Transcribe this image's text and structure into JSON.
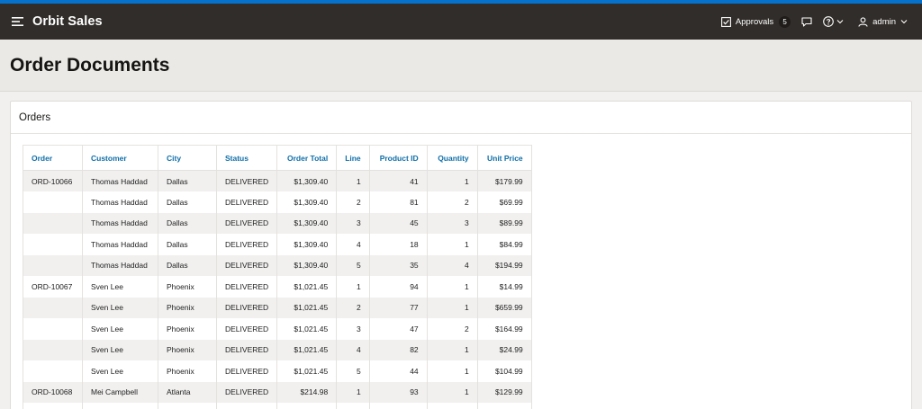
{
  "app": {
    "title": "Orbit Sales"
  },
  "topbar": {
    "approvals_label": "Approvals",
    "approvals_count": "5",
    "user_label": "admin"
  },
  "page": {
    "title": "Order Documents"
  },
  "region": {
    "title": "Orders"
  },
  "table": {
    "headers": {
      "order": "Order",
      "customer": "Customer",
      "city": "City",
      "status": "Status",
      "order_total": "Order Total",
      "line": "Line",
      "product_id": "Product ID",
      "quantity": "Quantity",
      "unit_price": "Unit Price"
    },
    "rows": [
      {
        "order": "ORD-10066",
        "customer": "Thomas Haddad",
        "city": "Dallas",
        "status": "DELIVERED",
        "order_total": "$1,309.40",
        "line": "1",
        "product_id": "41",
        "quantity": "1",
        "unit_price": "$179.99"
      },
      {
        "order": "",
        "customer": "Thomas Haddad",
        "city": "Dallas",
        "status": "DELIVERED",
        "order_total": "$1,309.40",
        "line": "2",
        "product_id": "81",
        "quantity": "2",
        "unit_price": "$69.99"
      },
      {
        "order": "",
        "customer": "Thomas Haddad",
        "city": "Dallas",
        "status": "DELIVERED",
        "order_total": "$1,309.40",
        "line": "3",
        "product_id": "45",
        "quantity": "3",
        "unit_price": "$89.99"
      },
      {
        "order": "",
        "customer": "Thomas Haddad",
        "city": "Dallas",
        "status": "DELIVERED",
        "order_total": "$1,309.40",
        "line": "4",
        "product_id": "18",
        "quantity": "1",
        "unit_price": "$84.99"
      },
      {
        "order": "",
        "customer": "Thomas Haddad",
        "city": "Dallas",
        "status": "DELIVERED",
        "order_total": "$1,309.40",
        "line": "5",
        "product_id": "35",
        "quantity": "4",
        "unit_price": "$194.99"
      },
      {
        "order": "ORD-10067",
        "customer": "Sven Lee",
        "city": "Phoenix",
        "status": "DELIVERED",
        "order_total": "$1,021.45",
        "line": "1",
        "product_id": "94",
        "quantity": "1",
        "unit_price": "$14.99"
      },
      {
        "order": "",
        "customer": "Sven Lee",
        "city": "Phoenix",
        "status": "DELIVERED",
        "order_total": "$1,021.45",
        "line": "2",
        "product_id": "77",
        "quantity": "1",
        "unit_price": "$659.99"
      },
      {
        "order": "",
        "customer": "Sven Lee",
        "city": "Phoenix",
        "status": "DELIVERED",
        "order_total": "$1,021.45",
        "line": "3",
        "product_id": "47",
        "quantity": "2",
        "unit_price": "$164.99"
      },
      {
        "order": "",
        "customer": "Sven Lee",
        "city": "Phoenix",
        "status": "DELIVERED",
        "order_total": "$1,021.45",
        "line": "4",
        "product_id": "82",
        "quantity": "1",
        "unit_price": "$24.99"
      },
      {
        "order": "",
        "customer": "Sven Lee",
        "city": "Phoenix",
        "status": "DELIVERED",
        "order_total": "$1,021.45",
        "line": "5",
        "product_id": "44",
        "quantity": "1",
        "unit_price": "$104.99"
      },
      {
        "order": "ORD-10068",
        "customer": "Mei Campbell",
        "city": "Atlanta",
        "status": "DELIVERED",
        "order_total": "$214.98",
        "line": "1",
        "product_id": "93",
        "quantity": "1",
        "unit_price": "$129.99"
      },
      {
        "order": "",
        "customer": "",
        "city": "",
        "status": "",
        "order_total": "",
        "line": "",
        "product_id": "",
        "quantity": "",
        "unit_price": ""
      }
    ]
  },
  "colors": {
    "topbar": "#312d2a",
    "accent": "#0572ce",
    "header_link": "#0e6ea8"
  },
  "icons": [
    "hamburger-menu-icon",
    "checkbox-icon",
    "chat-icon",
    "help-icon",
    "chevron-down-icon",
    "user-icon"
  ]
}
